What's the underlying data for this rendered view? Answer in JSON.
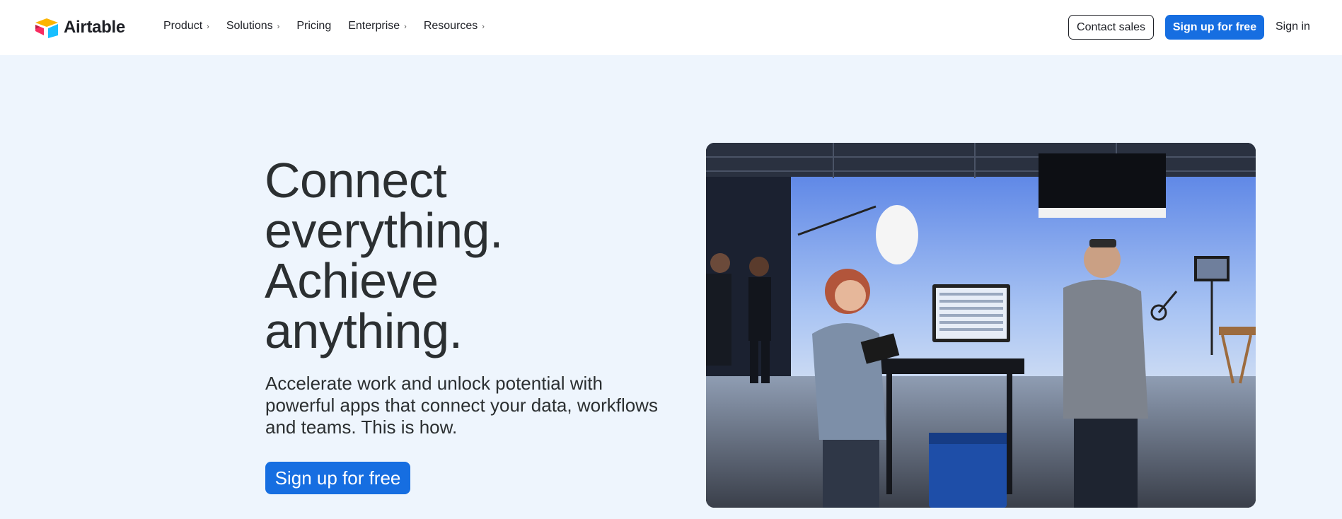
{
  "header": {
    "logo_text": "Airtable",
    "nav": [
      {
        "label": "Product",
        "has_chevron": true
      },
      {
        "label": "Solutions",
        "has_chevron": true
      },
      {
        "label": "Pricing",
        "has_chevron": false
      },
      {
        "label": "Enterprise",
        "has_chevron": true
      },
      {
        "label": "Resources",
        "has_chevron": true
      }
    ],
    "contact_sales": "Contact sales",
    "sign_up": "Sign up for free",
    "sign_in": "Sign in"
  },
  "hero": {
    "title_lines": [
      "Connect",
      "everything.",
      "Achieve",
      "anything."
    ],
    "subtitle": "Accelerate work and unlock potential with powerful apps that connect your data, workflows and teams. This is how.",
    "cta": "Sign up for free"
  },
  "icons": {
    "chevron": "chevron-right-icon",
    "logo": "airtable-logo-icon"
  },
  "colors": {
    "brand_blue": "#166ee1",
    "page_bg": "#eef5fd",
    "header_bg": "#ffffff",
    "text": "#2b2f31"
  }
}
